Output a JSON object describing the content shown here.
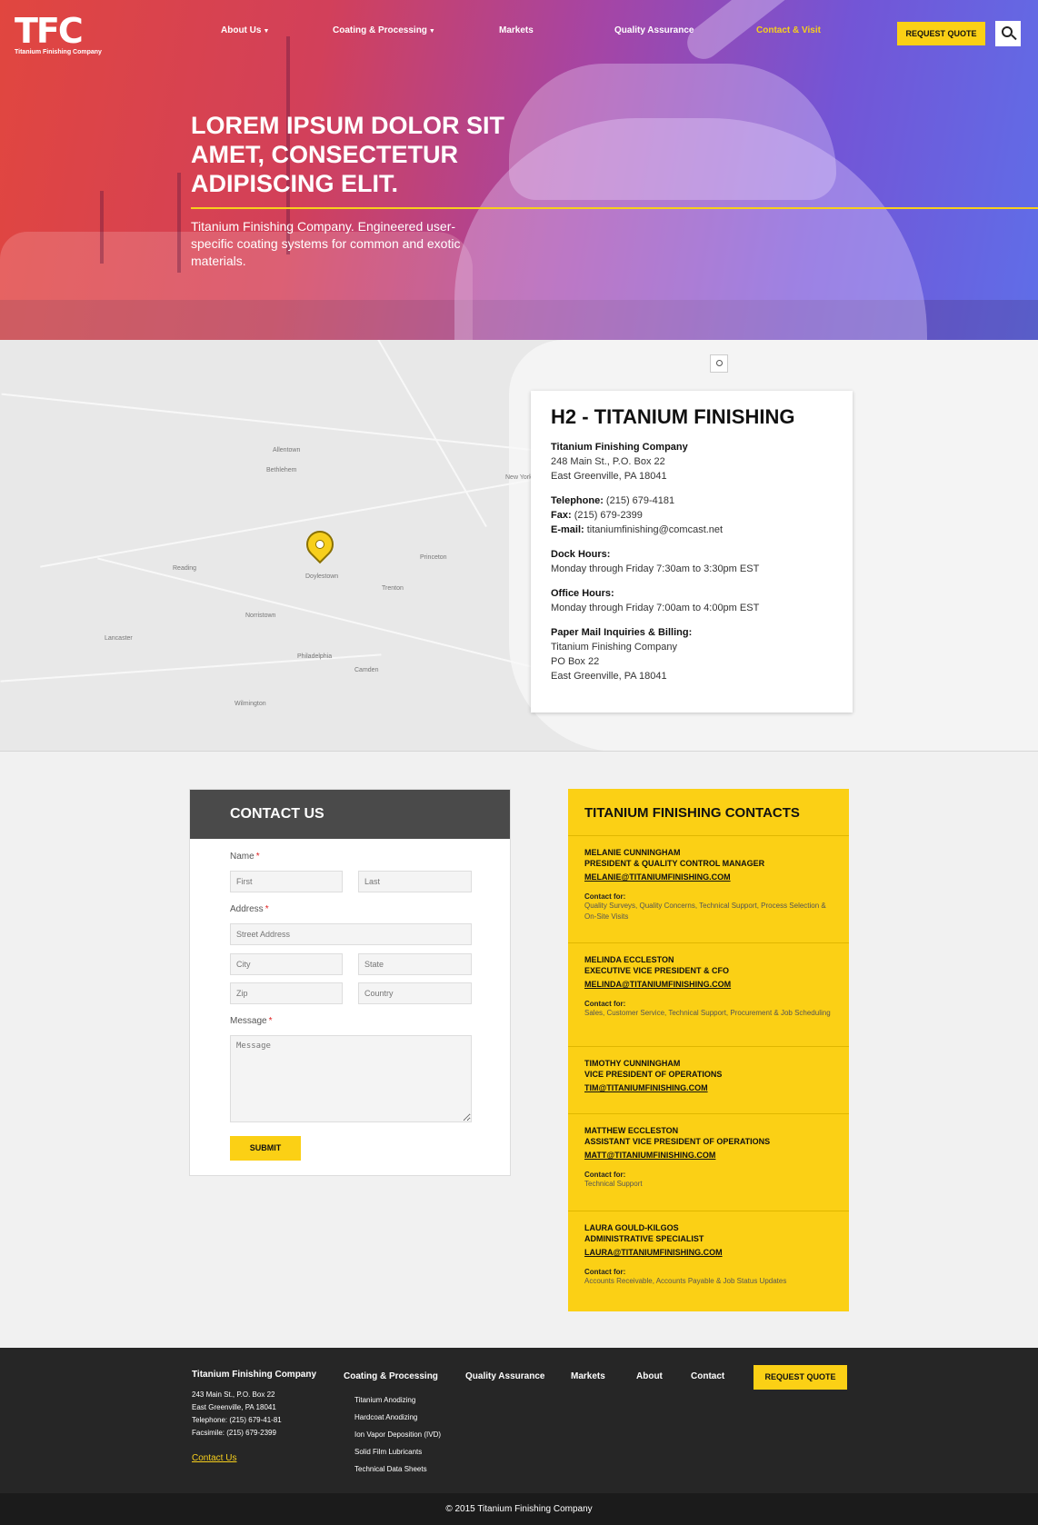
{
  "header": {
    "logo_mark": "TFC",
    "logo_sub": "Titanium Finishing Company",
    "nav": [
      {
        "label": "About Us",
        "has_menu": true
      },
      {
        "label": "Coating & Processing",
        "has_menu": true
      },
      {
        "label": "Markets",
        "has_menu": false
      },
      {
        "label": "Quality Assurance",
        "has_menu": false
      },
      {
        "label": "Contact & Visit",
        "has_menu": false,
        "active": true
      }
    ],
    "quote_button": "REQUEST QUOTE",
    "search_icon": "search-icon"
  },
  "hero": {
    "title": "LOREM IPSUM DOLOR SIT AMET, CONSECTETUR ADIPISCING ELIT.",
    "subtitle": "Titanium Finishing Company. Engineered user-specific coating systems for common and exotic materials."
  },
  "map": {
    "zoom_icon": "zoom-icon",
    "pin_icon": "map-pin-icon",
    "city_labels": [
      "Philadelphia",
      "Allentown",
      "Trenton",
      "New York",
      "Reading",
      "Lancaster",
      "Wilmington",
      "Princeton",
      "Doylestown",
      "Bethlehem",
      "Camden",
      "Norristown"
    ]
  },
  "location": {
    "title": "H2 - TITANIUM FINISHING",
    "company": "Titanium Finishing Company",
    "address_1": "248 Main St., P.O. Box 22",
    "address_2": "East Greenville, PA 18041",
    "telephone_label": "Telephone:",
    "telephone": "(215) 679-4181",
    "fax_label": "Fax:",
    "fax": "(215) 679-2399",
    "email_label": "E-mail:",
    "email": "titaniumfinishing@comcast.net",
    "dock_label": "Dock Hours:",
    "dock_hours": "Monday through Friday 7:30am to 3:30pm EST",
    "office_label": "Office Hours:",
    "office_hours": "Monday through Friday 7:00am to 4:00pm EST",
    "mail_label": "Paper Mail Inquiries & Billing:",
    "mail_1": "Titanium Finishing Company",
    "mail_2": "PO Box 22",
    "mail_3": "East Greenville, PA 18041"
  },
  "contact_form": {
    "title": "CONTACT US",
    "name_label": "Name",
    "first_placeholder": "First",
    "last_placeholder": "Last",
    "address_label": "Address",
    "street_placeholder": "Street Address",
    "city_placeholder": "City",
    "state_placeholder": "State",
    "zip_placeholder": "Zip",
    "country_placeholder": "Country",
    "message_label": "Message",
    "message_placeholder": "Message",
    "required_mark": "*",
    "submit": "SUBMIT"
  },
  "contacts": {
    "title": "TITANIUM FINISHING CONTACTS",
    "for_label": "Contact for:",
    "people": [
      {
        "name": "Melanie Cunningham",
        "role": "President & Quality Control Manager",
        "email": "MELANIE@TITANIUMFINISHING.COM",
        "for": "Quality Surveys, Quality Concerns, Technical Support, Process Selection & On-Site Visits"
      },
      {
        "name": "Melinda Eccleston",
        "role": "Executive Vice President & CFO",
        "email": "MELINDA@TITANIUMFINISHING.COM",
        "for": "Sales, Customer Service, Technical Support, Procurement & Job Scheduling"
      },
      {
        "name": "Timothy Cunningham",
        "role": "Vice President of Operations",
        "email": "TIM@TITANIUMFINISHING.COM",
        "for": ""
      },
      {
        "name": "Matthew Eccleston",
        "role": "Assistant Vice President of Operations",
        "email": "MATT@TITANIUMFINISHING.COM",
        "for": "Technical Support"
      },
      {
        "name": "Laura Gould-Kilgos",
        "role": "Administrative Specialist",
        "email": "LAURA@TITANIUMFINISHING.COM",
        "for": "Accounts Receivable, Accounts Payable & Job Status Updates"
      }
    ]
  },
  "footer": {
    "company": "Titanium Finishing Company",
    "address_1": "243 Main St., P.O. Box 22",
    "address_2": "East Greenville, PA 18041",
    "telephone": "Telephone: (215) 679-41-81",
    "facsimile": "Facsimile: (215) 679-2399",
    "contact_link": "Contact Us",
    "columns": [
      "Coating & Processing",
      "Quality Assurance",
      "Markets",
      "About",
      "Contact"
    ],
    "sub_links": [
      "Titanium Anodizing",
      "Hardcoat Anodizing",
      "Ion Vapor Deposition (IVD)",
      "Solid Film Lubricants",
      "Technical Data Sheets"
    ],
    "quote_button": "REQUEST QUOTE",
    "copyright": "© 2015 Titanium Finishing Company"
  },
  "colors": {
    "accent": "#fbd015",
    "hero_red": "#e1463f",
    "hero_blue": "#5f6ee8",
    "form_header": "#4a4a4a",
    "footer": "#262626"
  }
}
